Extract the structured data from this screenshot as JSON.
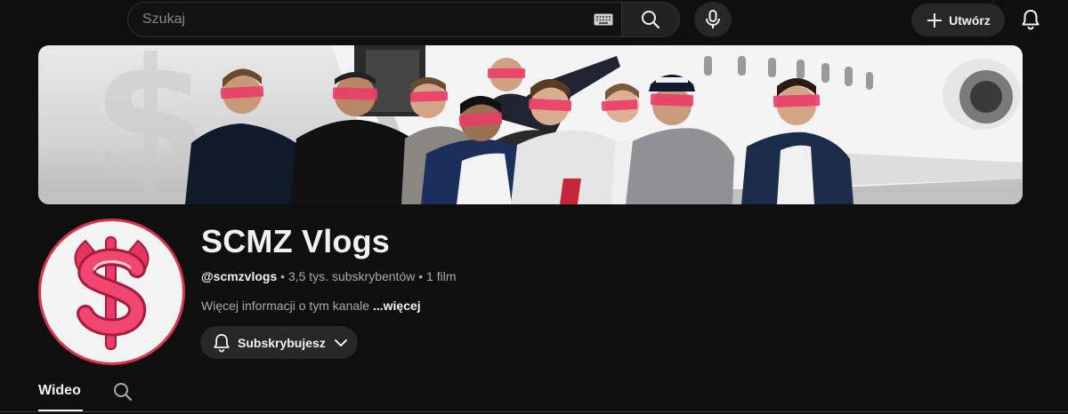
{
  "header": {
    "search": {
      "placeholder": "Szukaj",
      "value": ""
    },
    "create_label": "Utwórz",
    "icons": [
      "keyboard-icon",
      "search-icon",
      "microphone-icon",
      "plus-icon",
      "bell-icon"
    ]
  },
  "channel": {
    "name": "SCMZ Vlogs",
    "handle": "@scmzvlogs",
    "subscribers": "3,5 tys. subskrybentów",
    "videos": "1 film",
    "separator": "•",
    "description": "Więcej informacji o tym kanale",
    "more_link": "...więcej",
    "subscribe_label": "Subskrybujesz"
  },
  "tabs": [
    {
      "label": "Wideo",
      "active": true
    }
  ],
  "colors": {
    "background": "#0f0f0f",
    "surface": "#272727",
    "text_primary": "#f1f1f1",
    "text_secondary": "#aaaaaa",
    "avatar_accent": "#d9344f"
  }
}
